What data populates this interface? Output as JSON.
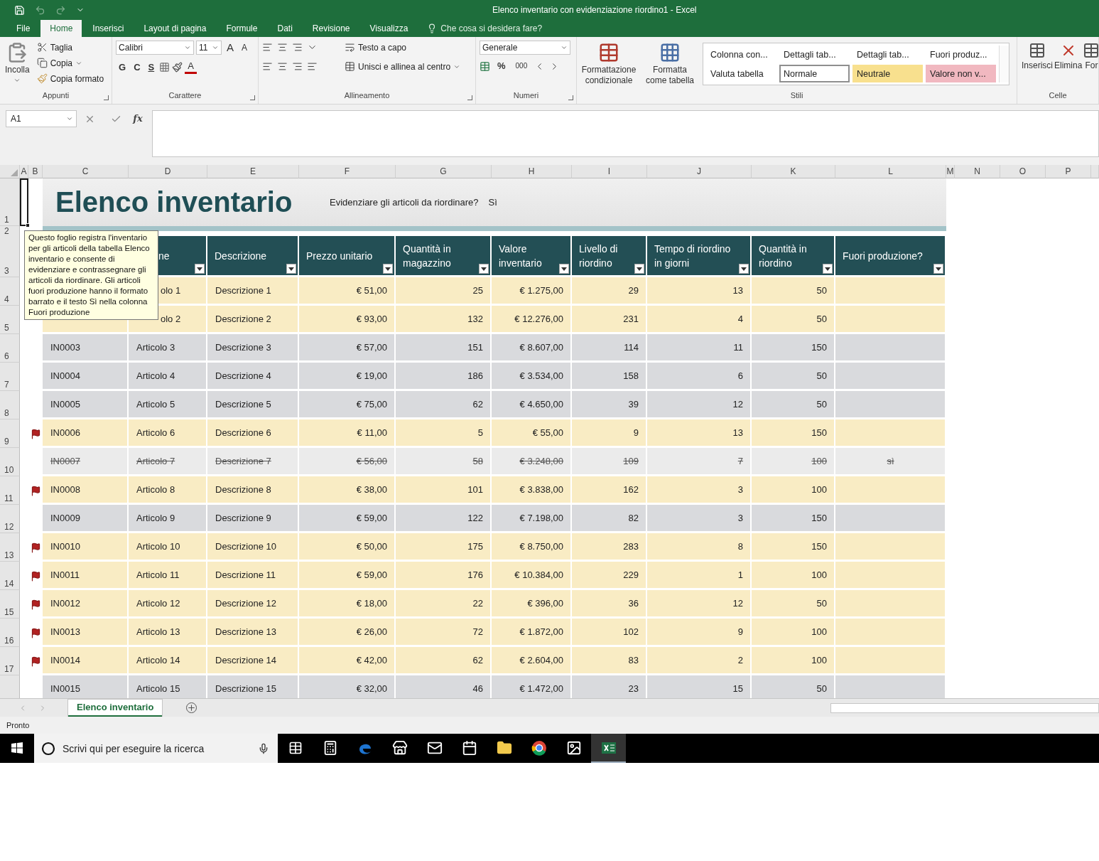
{
  "window": {
    "title": "Elenco inventario con evidenziazione riordino1 - Excel"
  },
  "ribbon_tabs": [
    {
      "label": "File",
      "selected": false
    },
    {
      "label": "Home",
      "selected": true
    },
    {
      "label": "Inserisci",
      "selected": false
    },
    {
      "label": "Layout di pagina",
      "selected": false
    },
    {
      "label": "Formule",
      "selected": false
    },
    {
      "label": "Dati",
      "selected": false
    },
    {
      "label": "Revisione",
      "selected": false
    },
    {
      "label": "Visualizza",
      "selected": false
    }
  ],
  "tell_me": "Che cosa si desidera fare?",
  "clipboard": {
    "label": "Appunti",
    "paste": "Incolla",
    "cut": "Taglia",
    "copy": "Copia",
    "format_painter": "Copia formato"
  },
  "font": {
    "label": "Carattere",
    "name": "Calibri",
    "size": "11",
    "grow": "A",
    "shrink": "A",
    "bold": "G",
    "italic": "C",
    "underline": "S",
    "font_color": "A"
  },
  "alignment": {
    "label": "Allineamento",
    "wrap_text": "Testo a capo",
    "merge_center": "Unisci e allinea al centro"
  },
  "number": {
    "label": "Numeri",
    "format": "Generale",
    "percent": "%",
    "thousands": "000"
  },
  "styles": {
    "label": "Stili",
    "conditional": "Formattazione condizionale",
    "format_table": "Formatta come tabella",
    "gallery": [
      {
        "label": "Colonna con...",
        "color": "#ffffff",
        "selected": false
      },
      {
        "label": "Dettagli tab...",
        "color": "#ffffff",
        "selected": false
      },
      {
        "label": "Dettagli tab...",
        "color": "#ffffff",
        "selected": false
      },
      {
        "label": "Fuori produz...",
        "color": "#ffffff",
        "selected": false
      },
      {
        "label": "Valuta tabella",
        "color": "#ffffff",
        "selected": false
      },
      {
        "label": "Normale",
        "color": "#ffffff",
        "selected": true
      },
      {
        "label": "Neutrale",
        "color": "#f8e08e",
        "selected": false
      },
      {
        "label": "Valore non v...",
        "color": "#f1b8c0",
        "selected": false
      }
    ]
  },
  "cells": {
    "label": "Celle",
    "insert": "Inserisci",
    "delete": "Elimina",
    "format": "For"
  },
  "formula_bar": {
    "name_box": "A1",
    "fx": "fx"
  },
  "sheet": {
    "columns": [
      "A",
      "B",
      "C",
      "D",
      "E",
      "F",
      "G",
      "H",
      "I",
      "J",
      "K",
      "L",
      "M",
      "N",
      "O",
      "P"
    ],
    "title": "Elenco inventario",
    "question": "Evidenziare gli articoli da riordinare?",
    "answer": "Sì",
    "header_rows": [
      "1",
      "2",
      "3"
    ],
    "table_columns": [
      "ne",
      "Descrizione",
      "Prezzo unitario",
      "Quantità in magazzino",
      "Valore inventario",
      "Livello di riordino",
      "Tempo di riordino in giorni",
      "Quantità in riordino",
      "Fuori produzione?"
    ],
    "rows": [
      {
        "row": "4",
        "flagged": false,
        "highlight": true,
        "discontinued": false,
        "name": "olo 1",
        "description": "Descrizione 1",
        "price": "€ 51,00",
        "stock": "25",
        "value": "€ 1.275,00",
        "reorder_level": "29",
        "reorder_days": "13",
        "reorder_qty": "50"
      },
      {
        "row": "5",
        "flagged": false,
        "highlight": true,
        "discontinued": false,
        "name": "olo 2",
        "description": "Descrizione 2",
        "price": "€ 93,00",
        "stock": "132",
        "value": "€ 12.276,00",
        "reorder_level": "231",
        "reorder_days": "4",
        "reorder_qty": "50"
      },
      {
        "row": "6",
        "flagged": false,
        "highlight": false,
        "discontinued": false,
        "id": "IN0003",
        "name": "Articolo 3",
        "description": "Descrizione 3",
        "price": "€ 57,00",
        "stock": "151",
        "value": "€ 8.607,00",
        "reorder_level": "114",
        "reorder_days": "11",
        "reorder_qty": "150"
      },
      {
        "row": "7",
        "flagged": false,
        "highlight": false,
        "discontinued": false,
        "id": "IN0004",
        "name": "Articolo 4",
        "description": "Descrizione 4",
        "price": "€ 19,00",
        "stock": "186",
        "value": "€ 3.534,00",
        "reorder_level": "158",
        "reorder_days": "6",
        "reorder_qty": "50"
      },
      {
        "row": "8",
        "flagged": false,
        "highlight": false,
        "discontinued": false,
        "id": "IN0005",
        "name": "Articolo 5",
        "description": "Descrizione 5",
        "price": "€ 75,00",
        "stock": "62",
        "value": "€ 4.650,00",
        "reorder_level": "39",
        "reorder_days": "12",
        "reorder_qty": "50"
      },
      {
        "row": "9",
        "flagged": true,
        "highlight": true,
        "discontinued": false,
        "id": "IN0006",
        "name": "Articolo 6",
        "description": "Descrizione 6",
        "price": "€ 11,00",
        "stock": "5",
        "value": "€ 55,00",
        "reorder_level": "9",
        "reorder_days": "13",
        "reorder_qty": "150"
      },
      {
        "row": "10",
        "flagged": false,
        "highlight": false,
        "discontinued": true,
        "id": "IN0007",
        "name": "Articolo 7",
        "description": "Descrizione 7",
        "price": "€ 56,00",
        "stock": "58",
        "value": "€ 3.248,00",
        "reorder_level": "109",
        "reorder_days": "7",
        "reorder_qty": "100",
        "discontinued_mark": "sì"
      },
      {
        "row": "11",
        "flagged": true,
        "highlight": true,
        "discontinued": false,
        "id": "IN0008",
        "name": "Articolo 8",
        "description": "Descrizione 8",
        "price": "€ 38,00",
        "stock": "101",
        "value": "€ 3.838,00",
        "reorder_level": "162",
        "reorder_days": "3",
        "reorder_qty": "100"
      },
      {
        "row": "12",
        "flagged": false,
        "highlight": false,
        "discontinued": false,
        "id": "IN0009",
        "name": "Articolo 9",
        "description": "Descrizione 9",
        "price": "€ 59,00",
        "stock": "122",
        "value": "€ 7.198,00",
        "reorder_level": "82",
        "reorder_days": "3",
        "reorder_qty": "150"
      },
      {
        "row": "13",
        "flagged": true,
        "highlight": true,
        "discontinued": false,
        "id": "IN0010",
        "name": "Articolo 10",
        "description": "Descrizione 10",
        "price": "€ 50,00",
        "stock": "175",
        "value": "€ 8.750,00",
        "reorder_level": "283",
        "reorder_days": "8",
        "reorder_qty": "150"
      },
      {
        "row": "14",
        "flagged": true,
        "highlight": true,
        "discontinued": false,
        "id": "IN0011",
        "name": "Articolo 11",
        "description": "Descrizione 11",
        "price": "€ 59,00",
        "stock": "176",
        "value": "€ 10.384,00",
        "reorder_level": "229",
        "reorder_days": "1",
        "reorder_qty": "100"
      },
      {
        "row": "15",
        "flagged": true,
        "highlight": true,
        "discontinued": false,
        "id": "IN0012",
        "name": "Articolo 12",
        "description": "Descrizione 12",
        "price": "€ 18,00",
        "stock": "22",
        "value": "€ 396,00",
        "reorder_level": "36",
        "reorder_days": "12",
        "reorder_qty": "50"
      },
      {
        "row": "16",
        "flagged": true,
        "highlight": true,
        "discontinued": false,
        "id": "IN0013",
        "name": "Articolo 13",
        "description": "Descrizione 13",
        "price": "€ 26,00",
        "stock": "72",
        "value": "€ 1.872,00",
        "reorder_level": "102",
        "reorder_days": "9",
        "reorder_qty": "100"
      },
      {
        "row": "17",
        "flagged": true,
        "highlight": true,
        "discontinued": false,
        "id": "IN0014",
        "name": "Articolo 14",
        "description": "Descrizione 14",
        "price": "€ 42,00",
        "stock": "62",
        "value": "€ 2.604,00",
        "reorder_level": "83",
        "reorder_days": "2",
        "reorder_qty": "100"
      },
      {
        "flagged": false,
        "highlight": false,
        "discontinued": false,
        "id": "IN0015",
        "name": "Articolo 15",
        "description": "Descrizione 15",
        "price": "€ 32,00",
        "stock": "46",
        "value": "€ 1.472,00",
        "reorder_level": "23",
        "reorder_days": "15",
        "reorder_qty": "50"
      }
    ],
    "comment": "Questo foglio registra l'inventario per gli articoli della tabella Elenco inventario e consente di evidenziare e contrassegnare gli articoli da riordinare. Gli articoli fuori produzione hanno il formato barrato e il testo Sì nella colonna Fuori produzione"
  },
  "sheet_tabs": [
    {
      "label": "Elenco inventario",
      "selected": true
    }
  ],
  "status_bar": {
    "text": "Pronto"
  },
  "taskbar": {
    "search_placeholder": "Scrivi qui per eseguire la ricerca",
    "apps": [
      {
        "kind": "taskview",
        "active": false
      },
      {
        "kind": "calculator",
        "active": false
      },
      {
        "kind": "edge",
        "active": false
      },
      {
        "kind": "store",
        "active": false
      },
      {
        "kind": "mail",
        "active": false
      },
      {
        "kind": "calendar",
        "active": false
      },
      {
        "kind": "files",
        "active": false
      },
      {
        "kind": "chrome",
        "active": false
      },
      {
        "kind": "photos",
        "active": false
      },
      {
        "kind": "excel",
        "active": true
      }
    ]
  }
}
